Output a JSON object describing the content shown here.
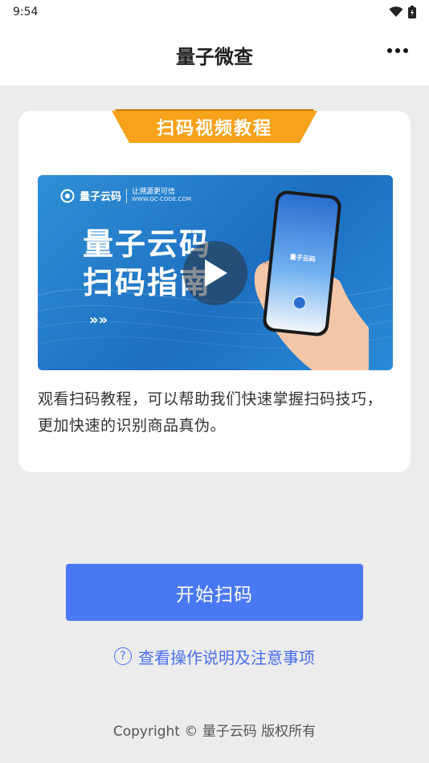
{
  "status_bar": {
    "time": "9:54"
  },
  "nav": {
    "title": "量子微查"
  },
  "card": {
    "ribbon_label": "扫码视频教程",
    "video": {
      "brand_name": "量子云码",
      "brand_slogan": "让溯源更可信",
      "brand_site": "WWW.QC-CODE.COM",
      "title_line1": "量子云码",
      "title_line2": "扫码指南",
      "arrows": "»»",
      "phone_app_name": "量子云码"
    },
    "description": "观看扫码教程，可以帮助我们快速掌握扫码技巧，更加快速的识别商品真伪。"
  },
  "actions": {
    "scan_label": "开始扫码",
    "help_label": "查看操作说明及注意事项",
    "help_icon_glyph": "?"
  },
  "footer": {
    "copyright": "Copyright © 量子云码 版权所有"
  },
  "colors": {
    "primary": "#4a78f5",
    "link": "#4a6ff0",
    "ribbon": "#f7a21b",
    "background": "#ececec"
  }
}
